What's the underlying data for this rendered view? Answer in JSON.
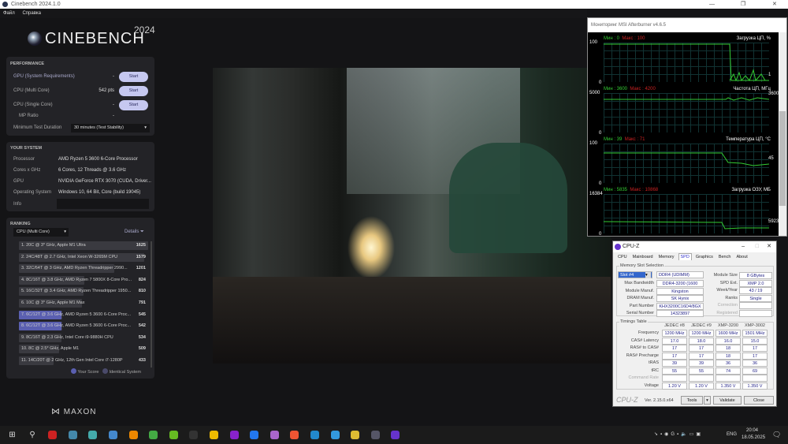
{
  "window": {
    "title": "Cinebench 2024.1.0",
    "menu": [
      "Файл",
      "Справка"
    ]
  },
  "brand": {
    "name": "CINEBENCH",
    "year": "2024",
    "footer": "MAXON"
  },
  "performance": {
    "heading": "PERFORMANCE",
    "rows": [
      {
        "label": "GPU (System Requirements)",
        "value": "-",
        "button": "Start"
      },
      {
        "label": "CPU (Multi Core)",
        "value": "542 pts",
        "button": "Start"
      },
      {
        "label": "CPU (Single Core)",
        "value": "-",
        "button": "Start"
      },
      {
        "label": "MP Ratio",
        "value": "-"
      }
    ],
    "duration_label": "Minimum Test Duration",
    "duration_value": "30 minutes (Test Stability)"
  },
  "system": {
    "heading": "YOUR SYSTEM",
    "rows": [
      {
        "label": "Processor",
        "value": "AMD Ryzen 5 3600 6-Core Processor"
      },
      {
        "label": "Cores x GHz",
        "value": "6 Cores, 12 Threads @ 3.6 GHz"
      },
      {
        "label": "GPU",
        "value": "NVIDIA GeForce RTX 3070 (CUDA, Driver..."
      },
      {
        "label": "Operating System",
        "value": "Windows 10, 64 Bit, Core (build 19045)"
      },
      {
        "label": "Info",
        "value": ""
      }
    ]
  },
  "ranking": {
    "heading": "RANKING",
    "mode": "CPU (Multi Core)",
    "details": "Details",
    "legend": [
      "Your Score",
      "Identical System"
    ],
    "items": [
      {
        "label": "1. 20C @ 3* GHz, Apple M1 Ultra",
        "score": 1625,
        "highlight": false
      },
      {
        "label": "2. 24C/48T @ 2.7 GHz, Intel Xeon W-3265M CPU",
        "score": 1579,
        "highlight": false
      },
      {
        "label": "3. 32C/64T @ 3 GHz, AMD Ryzen Threadripper 2990...",
        "score": 1201,
        "highlight": false
      },
      {
        "label": "4. 8C/16T @ 3.8 GHz, AMD Ryzen 7 5800X 8-Core Pro...",
        "score": 824,
        "highlight": false
      },
      {
        "label": "5. 16C/32T @ 3.4 GHz, AMD Ryzen Threadripper 1950...",
        "score": 810,
        "highlight": false
      },
      {
        "label": "6. 10C @ 3* GHz, Apple M1 Max",
        "score": 791,
        "highlight": false
      },
      {
        "label": "7. 6C/12T @ 3.6 GHz, AMD Ryzen 5 3600 6-Core Proc...",
        "score": 545,
        "highlight": "identical"
      },
      {
        "label": "8. 6C/12T @ 3.6 GHz, AMD Ryzen 5 3600 6-Core Proc...",
        "score": 542,
        "highlight": "yours"
      },
      {
        "label": "9. 8C/16T @ 2.3 GHz, Intel Core i9-9880H CPU",
        "score": 534,
        "highlight": false
      },
      {
        "label": "10. 8C @ 2.5* GHz, Apple M1",
        "score": 509,
        "highlight": false
      },
      {
        "label": "11. 14C/20T @ 2 GHz, 12th Gen Intel Core i7-1280P",
        "score": 433,
        "highlight": false
      }
    ]
  },
  "afterburner": {
    "title": "Мониторинг MSI Afterburner v4.6.5",
    "graphs": [
      {
        "name": "Загрузка ЦП, %",
        "min_label": "Мин : 0",
        "max_label": "Макс : 100",
        "top": "100",
        "bottom": "0",
        "current": "1"
      },
      {
        "name": "Частота ЦП, МГц",
        "min_label": "Мин : 3600",
        "max_label": "Макс : 4200",
        "top": "5000",
        "bottom": "0",
        "current": "3600"
      },
      {
        "name": "Температура ЦП, °C",
        "min_label": "Мин : 39",
        "max_label": "Макс : 71",
        "top": "100",
        "bottom": "0",
        "current": "45"
      },
      {
        "name": "Загрузка ОЗУ, МБ",
        "min_label": "Мин : 5835",
        "max_label": "Макс : 10868",
        "top": "16384",
        "bottom": "0",
        "current": "5923"
      }
    ]
  },
  "cpuz": {
    "title": "CPU-Z",
    "tabs": [
      "CPU",
      "Mainboard",
      "Memory",
      "SPD",
      "Graphics",
      "Bench",
      "About"
    ],
    "active_tab": "SPD",
    "slot_group": "Memory Slot Selection",
    "slot": "Slot #4",
    "type": "DDR4 (UDIMM)",
    "left": [
      {
        "label": "Max Bandwidth",
        "value": "DDR4-3200 (1600 MHz)"
      },
      {
        "label": "Module Manuf.",
        "value": "Kingston"
      },
      {
        "label": "DRAM Manuf.",
        "value": "SK Hynix"
      },
      {
        "label": "Part Number",
        "value": "KHX3200C16D4/8GX"
      },
      {
        "label": "Serial Number",
        "value": "14323897"
      }
    ],
    "right": [
      {
        "label": "Module Size",
        "value": "8 GBytes"
      },
      {
        "label": "SPD Ext.",
        "value": "XMP 2.0"
      },
      {
        "label": "Week/Year",
        "value": "43 / 19"
      },
      {
        "label": "Ranks",
        "value": "Single"
      },
      {
        "label": "Correction",
        "value": ""
      },
      {
        "label": "Registered",
        "value": ""
      }
    ],
    "timings_group": "Timings Table",
    "columns": [
      "JEDEC #8",
      "JEDEC #9",
      "XMP-3200",
      "XMP-3002"
    ],
    "timings": [
      {
        "label": "Frequency",
        "values": [
          "1200 MHz",
          "1200 MHz",
          "1600 MHz",
          "1501 MHz"
        ]
      },
      {
        "label": "CAS# Latency",
        "values": [
          "17.0",
          "18.0",
          "16.0",
          "15.0"
        ]
      },
      {
        "label": "RAS# to CAS#",
        "values": [
          "17",
          "17",
          "18",
          "17"
        ]
      },
      {
        "label": "RAS# Precharge",
        "values": [
          "17",
          "17",
          "18",
          "17"
        ]
      },
      {
        "label": "tRAS",
        "values": [
          "39",
          "39",
          "36",
          "36"
        ]
      },
      {
        "label": "tRC",
        "values": [
          "55",
          "55",
          "74",
          "69"
        ]
      },
      {
        "label": "Command Rate",
        "values": [
          "",
          "",
          "",
          ""
        ]
      },
      {
        "label": "Voltage",
        "values": [
          "1.20 V",
          "1.20 V",
          "1.350 V",
          "1.350 V"
        ]
      }
    ],
    "brand": "CPU-Z",
    "version": "Ver. 2.15.0.x64",
    "tools": "Tools",
    "validate": "Validate",
    "close": "Close"
  },
  "taskbar": {
    "lang": "ENG",
    "time": "20:04",
    "date": "18.05.2025",
    "apps": [
      "start",
      "search",
      "app-red",
      "calculator",
      "app",
      "app",
      "vlc",
      "xbox",
      "nvidia",
      "epic-games",
      "rockstar",
      "app-purple",
      "app-blue",
      "app",
      "ea",
      "steam",
      "app",
      "chrome",
      "cinebench",
      "cpu-z"
    ],
    "app_colors": [
      "#ddd",
      "#ddd",
      "#c22",
      "#48a",
      "#4aa",
      "#48c",
      "#e80",
      "#4a4",
      "#6b2",
      "#333",
      "#eb0",
      "#82c",
      "#27e",
      "#a6c",
      "#e53",
      "#28c",
      "#39d",
      "#db3",
      "#556",
      "#63c"
    ]
  }
}
